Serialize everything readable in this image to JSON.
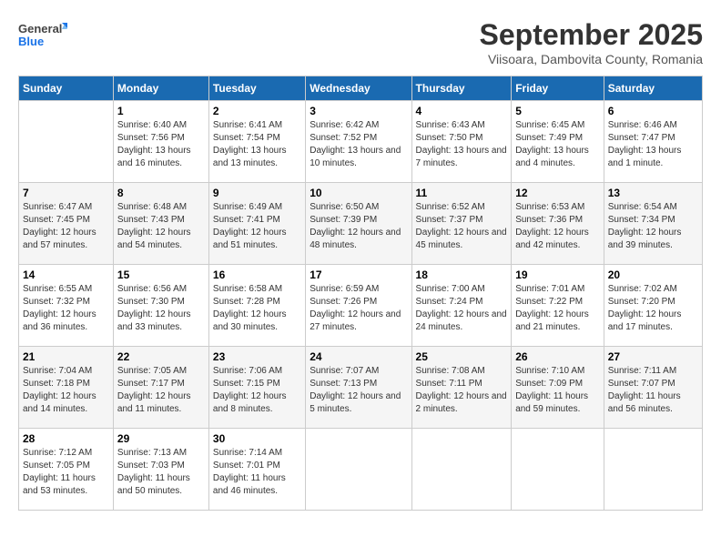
{
  "header": {
    "logo_line1": "General",
    "logo_line2": "Blue",
    "month": "September 2025",
    "location": "Viisoara, Dambovita County, Romania"
  },
  "weekdays": [
    "Sunday",
    "Monday",
    "Tuesday",
    "Wednesday",
    "Thursday",
    "Friday",
    "Saturday"
  ],
  "weeks": [
    [
      {
        "day": "",
        "sunrise": "",
        "sunset": "",
        "daylight": ""
      },
      {
        "day": "1",
        "sunrise": "Sunrise: 6:40 AM",
        "sunset": "Sunset: 7:56 PM",
        "daylight": "Daylight: 13 hours and 16 minutes."
      },
      {
        "day": "2",
        "sunrise": "Sunrise: 6:41 AM",
        "sunset": "Sunset: 7:54 PM",
        "daylight": "Daylight: 13 hours and 13 minutes."
      },
      {
        "day": "3",
        "sunrise": "Sunrise: 6:42 AM",
        "sunset": "Sunset: 7:52 PM",
        "daylight": "Daylight: 13 hours and 10 minutes."
      },
      {
        "day": "4",
        "sunrise": "Sunrise: 6:43 AM",
        "sunset": "Sunset: 7:50 PM",
        "daylight": "Daylight: 13 hours and 7 minutes."
      },
      {
        "day": "5",
        "sunrise": "Sunrise: 6:45 AM",
        "sunset": "Sunset: 7:49 PM",
        "daylight": "Daylight: 13 hours and 4 minutes."
      },
      {
        "day": "6",
        "sunrise": "Sunrise: 6:46 AM",
        "sunset": "Sunset: 7:47 PM",
        "daylight": "Daylight: 13 hours and 1 minute."
      }
    ],
    [
      {
        "day": "7",
        "sunrise": "Sunrise: 6:47 AM",
        "sunset": "Sunset: 7:45 PM",
        "daylight": "Daylight: 12 hours and 57 minutes."
      },
      {
        "day": "8",
        "sunrise": "Sunrise: 6:48 AM",
        "sunset": "Sunset: 7:43 PM",
        "daylight": "Daylight: 12 hours and 54 minutes."
      },
      {
        "day": "9",
        "sunrise": "Sunrise: 6:49 AM",
        "sunset": "Sunset: 7:41 PM",
        "daylight": "Daylight: 12 hours and 51 minutes."
      },
      {
        "day": "10",
        "sunrise": "Sunrise: 6:50 AM",
        "sunset": "Sunset: 7:39 PM",
        "daylight": "Daylight: 12 hours and 48 minutes."
      },
      {
        "day": "11",
        "sunrise": "Sunrise: 6:52 AM",
        "sunset": "Sunset: 7:37 PM",
        "daylight": "Daylight: 12 hours and 45 minutes."
      },
      {
        "day": "12",
        "sunrise": "Sunrise: 6:53 AM",
        "sunset": "Sunset: 7:36 PM",
        "daylight": "Daylight: 12 hours and 42 minutes."
      },
      {
        "day": "13",
        "sunrise": "Sunrise: 6:54 AM",
        "sunset": "Sunset: 7:34 PM",
        "daylight": "Daylight: 12 hours and 39 minutes."
      }
    ],
    [
      {
        "day": "14",
        "sunrise": "Sunrise: 6:55 AM",
        "sunset": "Sunset: 7:32 PM",
        "daylight": "Daylight: 12 hours and 36 minutes."
      },
      {
        "day": "15",
        "sunrise": "Sunrise: 6:56 AM",
        "sunset": "Sunset: 7:30 PM",
        "daylight": "Daylight: 12 hours and 33 minutes."
      },
      {
        "day": "16",
        "sunrise": "Sunrise: 6:58 AM",
        "sunset": "Sunset: 7:28 PM",
        "daylight": "Daylight: 12 hours and 30 minutes."
      },
      {
        "day": "17",
        "sunrise": "Sunrise: 6:59 AM",
        "sunset": "Sunset: 7:26 PM",
        "daylight": "Daylight: 12 hours and 27 minutes."
      },
      {
        "day": "18",
        "sunrise": "Sunrise: 7:00 AM",
        "sunset": "Sunset: 7:24 PM",
        "daylight": "Daylight: 12 hours and 24 minutes."
      },
      {
        "day": "19",
        "sunrise": "Sunrise: 7:01 AM",
        "sunset": "Sunset: 7:22 PM",
        "daylight": "Daylight: 12 hours and 21 minutes."
      },
      {
        "day": "20",
        "sunrise": "Sunrise: 7:02 AM",
        "sunset": "Sunset: 7:20 PM",
        "daylight": "Daylight: 12 hours and 17 minutes."
      }
    ],
    [
      {
        "day": "21",
        "sunrise": "Sunrise: 7:04 AM",
        "sunset": "Sunset: 7:18 PM",
        "daylight": "Daylight: 12 hours and 14 minutes."
      },
      {
        "day": "22",
        "sunrise": "Sunrise: 7:05 AM",
        "sunset": "Sunset: 7:17 PM",
        "daylight": "Daylight: 12 hours and 11 minutes."
      },
      {
        "day": "23",
        "sunrise": "Sunrise: 7:06 AM",
        "sunset": "Sunset: 7:15 PM",
        "daylight": "Daylight: 12 hours and 8 minutes."
      },
      {
        "day": "24",
        "sunrise": "Sunrise: 7:07 AM",
        "sunset": "Sunset: 7:13 PM",
        "daylight": "Daylight: 12 hours and 5 minutes."
      },
      {
        "day": "25",
        "sunrise": "Sunrise: 7:08 AM",
        "sunset": "Sunset: 7:11 PM",
        "daylight": "Daylight: 12 hours and 2 minutes."
      },
      {
        "day": "26",
        "sunrise": "Sunrise: 7:10 AM",
        "sunset": "Sunset: 7:09 PM",
        "daylight": "Daylight: 11 hours and 59 minutes."
      },
      {
        "day": "27",
        "sunrise": "Sunrise: 7:11 AM",
        "sunset": "Sunset: 7:07 PM",
        "daylight": "Daylight: 11 hours and 56 minutes."
      }
    ],
    [
      {
        "day": "28",
        "sunrise": "Sunrise: 7:12 AM",
        "sunset": "Sunset: 7:05 PM",
        "daylight": "Daylight: 11 hours and 53 minutes."
      },
      {
        "day": "29",
        "sunrise": "Sunrise: 7:13 AM",
        "sunset": "Sunset: 7:03 PM",
        "daylight": "Daylight: 11 hours and 50 minutes."
      },
      {
        "day": "30",
        "sunrise": "Sunrise: 7:14 AM",
        "sunset": "Sunset: 7:01 PM",
        "daylight": "Daylight: 11 hours and 46 minutes."
      },
      {
        "day": "",
        "sunrise": "",
        "sunset": "",
        "daylight": ""
      },
      {
        "day": "",
        "sunrise": "",
        "sunset": "",
        "daylight": ""
      },
      {
        "day": "",
        "sunrise": "",
        "sunset": "",
        "daylight": ""
      },
      {
        "day": "",
        "sunrise": "",
        "sunset": "",
        "daylight": ""
      }
    ]
  ]
}
